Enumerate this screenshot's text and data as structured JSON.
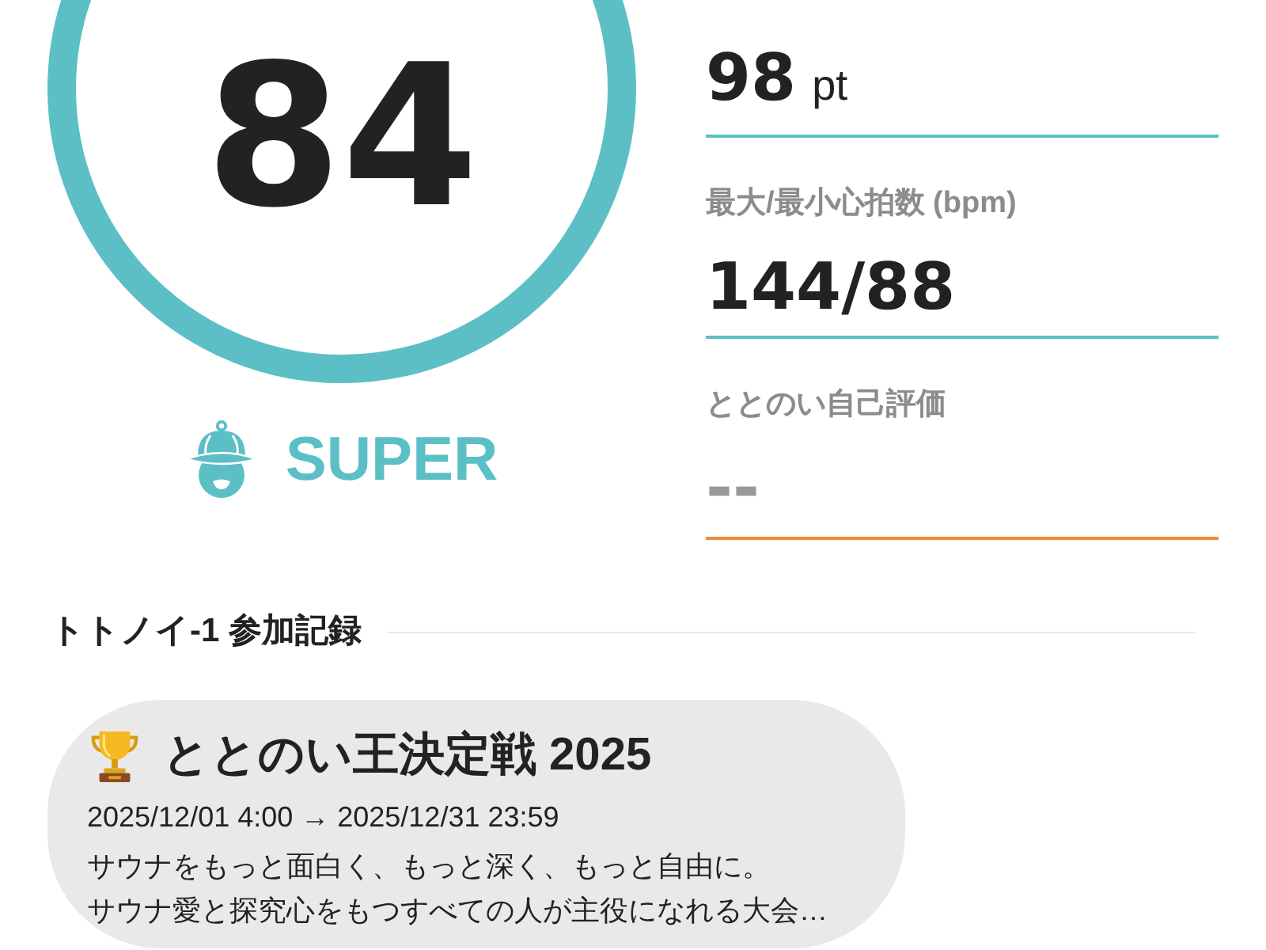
{
  "score_panel": {
    "value": "84",
    "rank": "SUPER"
  },
  "stats": [
    {
      "value": "98",
      "unit": "pt",
      "filled": true
    },
    {
      "label": "最大/最小心拍数 (bpm)",
      "value": "144/88",
      "filled": true
    },
    {
      "label": "ととのい自己評価",
      "placeholder": "--",
      "filled": false
    }
  ],
  "records": {
    "title": "トトノイ-1 参加記録",
    "events": [
      {
        "title": "ととのい王決定戦 2025",
        "period": "2025/12/01 4:00 → 2025/12/31 23:59",
        "description_lines": [
          "サウナをもっと面白く、もっと深く、もっと自由に。",
          "サウナ愛と探究心をもつすべての人が主役になれる大会…"
        ]
      }
    ]
  }
}
